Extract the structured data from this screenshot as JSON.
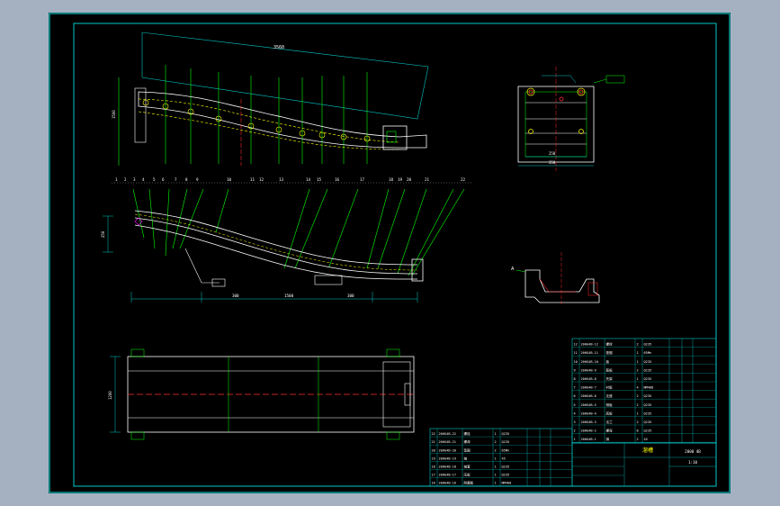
{
  "drawing": {
    "type": "CAD assembly drawing viewer",
    "colors": {
      "background": "#a5b1c1",
      "sheet": "#000000",
      "frame": "#00c8c8",
      "outline": "#ffffff",
      "geometry": "#00ff00",
      "dimension": "#00c8c8",
      "centerline": "#ff2a2a",
      "hidden": "#ffff00",
      "marker": "#ff00ff"
    },
    "overall_dim_top": "3560",
    "top_view_width": "1200",
    "bottom_dim_1": "300",
    "bottom_dim_2": "1500",
    "bottom_dim_3": "300",
    "section_dim_width": "250",
    "section_dim_total": "350",
    "section_a": "A",
    "title_block": {
      "name": "溜槽",
      "drawing_number": "2000 4B",
      "scale": "1:10"
    },
    "top_balloons": [
      "1",
      "2",
      "3",
      "4",
      "5",
      "6",
      "7",
      "8",
      "9",
      "10",
      "11",
      "12",
      "13",
      "14",
      "15",
      "16",
      "17",
      "18",
      "19",
      "20",
      "21",
      "22"
    ],
    "bom_right": [
      [
        "12",
        "20HG4B-12",
        "螺栓",
        "2",
        "Q235",
        ""
      ],
      [
        "11",
        "20HG4B-11",
        "垫圈",
        "1",
        "65Mn",
        ""
      ],
      [
        "10",
        "20HG4B-10",
        "板",
        "1",
        "Q235",
        ""
      ],
      [
        "9",
        "20HG4B-9",
        "筋板",
        "2",
        "Q235",
        ""
      ],
      [
        "8",
        "20HG4B-8",
        "托架",
        "1",
        "Q235",
        ""
      ],
      [
        "7",
        "20HG4B-7",
        "衬板",
        "4",
        "NM400",
        ""
      ],
      [
        "6",
        "20HG4B-6",
        "支座",
        "2",
        "Q235",
        ""
      ],
      [
        "5",
        "20HG4B-5",
        "侧板",
        "2",
        "Q235",
        ""
      ],
      [
        "4",
        "20HG4B-4",
        "底板",
        "1",
        "Q235",
        ""
      ],
      [
        "3",
        "20HG4B-3",
        "法兰",
        "2",
        "Q235",
        ""
      ],
      [
        "2",
        "20HG4B-2",
        "螺母",
        "8",
        "Q235",
        ""
      ],
      [
        "1",
        "20HG4B-1",
        "销",
        "2",
        "45",
        ""
      ]
    ],
    "bom_left": [
      [
        "22",
        "20HG4B-22",
        "螺栓",
        "1",
        "Q235",
        ""
      ],
      [
        "21",
        "20HG4B-21",
        "螺母",
        "2",
        "Q235",
        ""
      ],
      [
        "20",
        "20HG4B-20",
        "垫圈",
        "2",
        "65Mn",
        ""
      ],
      [
        "19",
        "20HG4B-19",
        "轴",
        "1",
        "45",
        ""
      ],
      [
        "18",
        "20HG4B-18",
        "轴套",
        "1",
        "Q235",
        ""
      ],
      [
        "17",
        "20HG4B-17",
        "压板",
        "1",
        "Q235",
        ""
      ],
      [
        "16",
        "20HG4B-16",
        "耐磨板",
        "1",
        "NM400",
        ""
      ]
    ]
  }
}
